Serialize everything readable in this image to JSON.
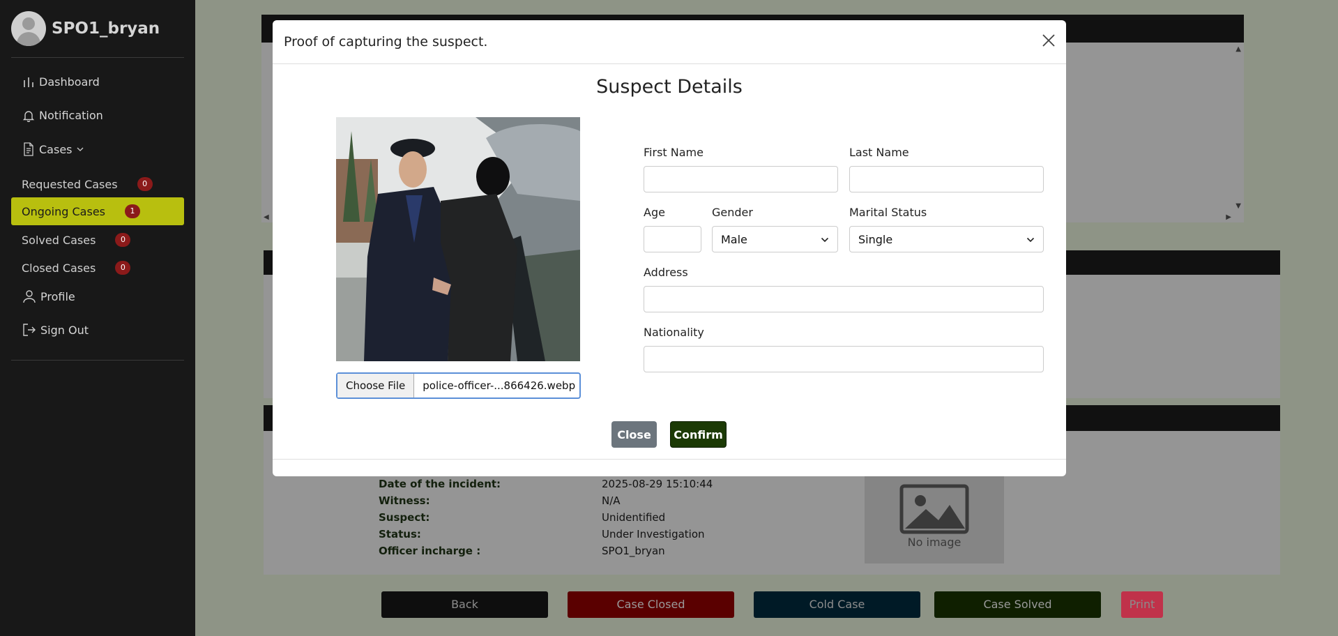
{
  "sidebar": {
    "username": "SPO1_bryan",
    "nav": {
      "dashboard": "Dashboard",
      "notification": "Notification",
      "cases": "Cases",
      "profile": "Profile",
      "signout": "Sign Out"
    },
    "case_items": [
      {
        "label": "Requested Cases",
        "count": "0"
      },
      {
        "label": "Ongoing Cases",
        "count": "1"
      },
      {
        "label": "Solved Cases",
        "count": "0"
      },
      {
        "label": "Closed Cases",
        "count": "0"
      }
    ]
  },
  "case_details": {
    "labels": [
      "Date of the incident:",
      "Witness:",
      "Suspect:",
      "Status:",
      "Officer incharge :"
    ],
    "values": [
      "2025-08-29 15:10:44",
      "N/A",
      "Unidentified",
      "Under Investigation",
      "SPO1_bryan"
    ],
    "no_image_text": "No image"
  },
  "actions": {
    "back": "Back",
    "case_closed": "Case Closed",
    "cold_case": "Cold Case",
    "case_solved": "Case Solved",
    "print": "Print"
  },
  "modal": {
    "title": "Proof of capturing the suspect.",
    "section_title": "Suspect Details",
    "file": {
      "button": "Choose File",
      "filename": "police-officer-...866426.webp"
    },
    "labels": {
      "first_name": "First Name",
      "last_name": "Last Name",
      "age": "Age",
      "gender": "Gender",
      "marital_status": "Marital Status",
      "address": "Address",
      "nationality": "Nationality"
    },
    "values": {
      "first_name": "",
      "last_name": "",
      "age": "",
      "gender": "Male",
      "marital_status": "Single",
      "address": "",
      "nationality": ""
    },
    "buttons": {
      "close": "Close",
      "confirm": "Confirm"
    }
  },
  "colors": {
    "sidebar_bg": "#181818",
    "active_item": "#b8bf0f",
    "badge": "#8b1a1a",
    "confirm": "#1c3a05",
    "close": "#6c757d",
    "case_closed": "#5a0000",
    "cold_case": "#001a26",
    "case_solved": "#0f1f00",
    "print": "#c0324a"
  }
}
